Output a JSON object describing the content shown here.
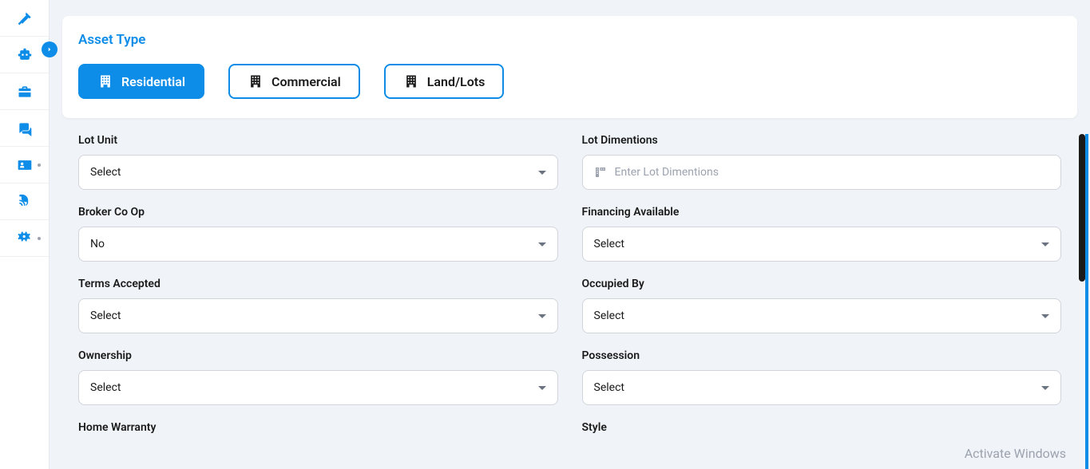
{
  "card": {
    "title": "Asset Type"
  },
  "assetTypes": {
    "residential": "Residential",
    "commercial": "Commercial",
    "landlots": "Land/Lots"
  },
  "form": {
    "lotUnit": {
      "label": "Lot Unit",
      "value": "Select"
    },
    "lotDimensions": {
      "label": "Lot Dimentions",
      "placeholder": "Enter Lot Dimentions"
    },
    "brokerCoOp": {
      "label": "Broker Co Op",
      "value": "No"
    },
    "financingAvailable": {
      "label": "Financing Available",
      "value": "Select"
    },
    "termsAccepted": {
      "label": "Terms Accepted",
      "value": "Select"
    },
    "occupiedBy": {
      "label": "Occupied By",
      "value": "Select"
    },
    "ownership": {
      "label": "Ownership",
      "value": "Select"
    },
    "possession": {
      "label": "Possession",
      "value": "Select"
    },
    "homeWarranty": {
      "label": "Home Warranty"
    },
    "style": {
      "label": "Style"
    }
  },
  "watermark": "Activate Windows"
}
